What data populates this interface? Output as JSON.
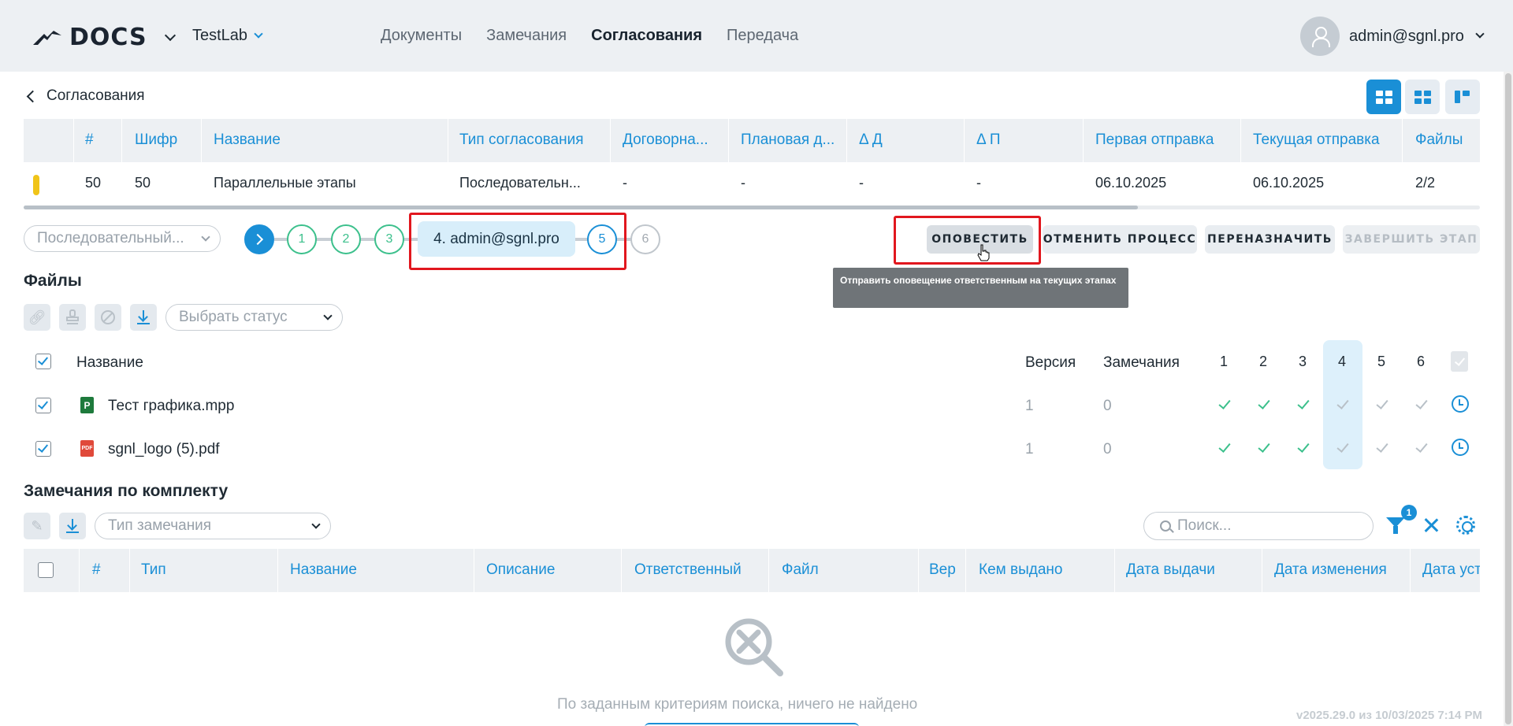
{
  "header": {
    "logo_text": "DOCS",
    "project": "TestLab",
    "nav": [
      "Документы",
      "Замечания",
      "Согласования",
      "Передача"
    ],
    "nav_active_index": 2,
    "user": "admin@sgnl.pro"
  },
  "breadcrumb": "Согласования",
  "approvals_table": {
    "columns": [
      "#",
      "Шифр",
      "Название",
      "Тип согласования",
      "Договорна...",
      "Плановая д...",
      "Δ Д",
      "Δ П",
      "Первая отправка",
      "Текущая отправка",
      "Файлы"
    ],
    "row": {
      "status_color": "#f0c419",
      "num": "50",
      "code": "50",
      "name": "Параллельные этапы",
      "type": "Последовательн...",
      "contract": "-",
      "planned": "-",
      "dd": "-",
      "dp": "-",
      "first_sent": "06.10.2025",
      "current_sent": "06.10.2025",
      "files": "2/2"
    }
  },
  "process": {
    "type_select": "Последовательный...",
    "steps": [
      "1",
      "2",
      "3",
      "4. admin@sgnl.pro",
      "5",
      "6"
    ],
    "current_step": 4
  },
  "actions": {
    "notify": "ОПОВЕСТИТЬ",
    "cancel_process": "ОТМЕНИТЬ ПРОЦЕСС",
    "reassign": "ПЕРЕНАЗНАЧИТЬ",
    "finish_stage": "ЗАВЕРШИТЬ ЭТАП",
    "tooltip": "Отправить оповещение ответственным на текущих этапах"
  },
  "files": {
    "title": "Файлы",
    "status_select": "Выбрать статус",
    "columns": {
      "name": "Название",
      "version": "Версия",
      "remarks": "Замечания"
    },
    "stages": [
      "1",
      "2",
      "3",
      "4",
      "5",
      "6"
    ],
    "rows": [
      {
        "name": "Тест графика.mpp",
        "icon": "P",
        "icon_color": "#1e7a3c",
        "version": "1",
        "remarks": "0"
      },
      {
        "name": "sgnl_logo (5).pdf",
        "icon": "PDF",
        "icon_color": "#e0493a",
        "version": "1",
        "remarks": "0"
      }
    ]
  },
  "remarks": {
    "title": "Замечания по комплекту",
    "type_select": "Тип замечания",
    "search_placeholder": "Поиск...",
    "filter_count": "1",
    "columns": [
      "#",
      "Тип",
      "Название",
      "Описание",
      "Ответственный",
      "Файл",
      "Вер",
      "Кем выдано",
      "Дата выдачи",
      "Дата изменения",
      "Дата уст"
    ],
    "empty_text": "По заданным критериям поиска, ничего не найдено"
  },
  "version_info": "v2025.29.0 из 10/03/2025 7:14 PM",
  "colors": {
    "accent": "#1a8fd6",
    "success": "#3cc08c",
    "highlight": "#e1171e"
  }
}
